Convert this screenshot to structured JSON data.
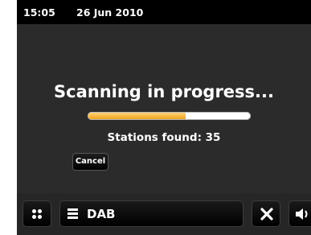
{
  "status": {
    "time": "15:05",
    "date": "26 Jun 2010"
  },
  "scan": {
    "title": "Scanning in progress...",
    "progress_fraction": 0.6,
    "stations_found": "Stations found: 35",
    "cancel_label": "Cancel"
  },
  "bottom_bar": {
    "menu_label": "DAB"
  },
  "colors": {
    "progress_fill": "#f0a318",
    "background": "#2b2b2b",
    "status_bar": "#000000"
  },
  "icons": {
    "home": "grid-dots-icon",
    "menu": "menu-lines-icon",
    "close": "close-icon",
    "volume": "speaker-icon"
  }
}
